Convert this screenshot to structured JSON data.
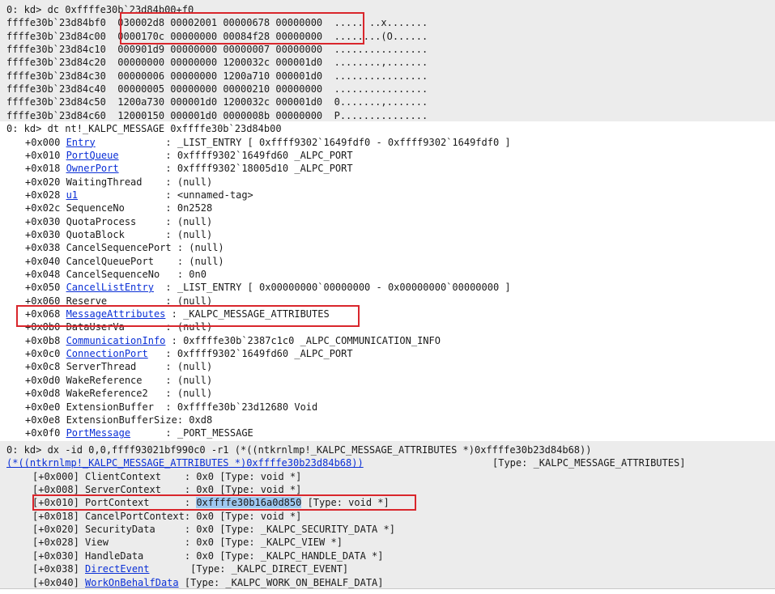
{
  "dump": {
    "prompt_prefix": "0: kd> ",
    "command": "dc 0xffffe30b`23d84b00+f0",
    "rows": [
      {
        "addr": "ffffe30b`23d84bf0",
        "data": "030002d8 00002001 00000678 00000000",
        "ascii": "..... ..x......."
      },
      {
        "addr": "ffffe30b`23d84c00",
        "data": "0000170c 00000000 00084f28 00000000",
        "ascii": "........(O......"
      },
      {
        "addr": "ffffe30b`23d84c10",
        "data": "000901d9 00000000 00000007 00000000",
        "ascii": "................"
      },
      {
        "addr": "ffffe30b`23d84c20",
        "data": "00000000 00000000 1200032c 000001d0",
        "ascii": "........,......."
      },
      {
        "addr": "ffffe30b`23d84c30",
        "data": "00000006 00000000 1200a710 000001d0",
        "ascii": "................"
      },
      {
        "addr": "ffffe30b`23d84c40",
        "data": "00000005 00000000 00000210 00000000",
        "ascii": "................"
      },
      {
        "addr": "ffffe30b`23d84c50",
        "data": "1200a730 000001d0 1200032c 000001d0",
        "ascii": "0.......,......."
      },
      {
        "addr": "ffffe30b`23d84c60",
        "data": "12000150 000001d0 0000008b 00000000",
        "ascii": "P..............."
      }
    ]
  },
  "dt": {
    "prompt_prefix": "0: kd> ",
    "command": "dt nt!_KALPC_MESSAGE 0xffffe30b`23d84b00",
    "fields": [
      {
        "offset": "+0x000 ",
        "name": "Entry",
        "link": true,
        "pad": "            ",
        "value": ": _LIST_ENTRY [ 0xffff9302`1649fdf0 - 0xffff9302`1649fdf0 ]"
      },
      {
        "offset": "+0x010 ",
        "name": "PortQueue",
        "link": true,
        "pad": "        ",
        "value": ": 0xffff9302`1649fd60 _ALPC_PORT"
      },
      {
        "offset": "+0x018 ",
        "name": "OwnerPort",
        "link": true,
        "pad": "        ",
        "value": ": 0xffff9302`18005d10 _ALPC_PORT"
      },
      {
        "offset": "+0x020 ",
        "name": "WaitingThread",
        "link": false,
        "pad": "    ",
        "value": ": (null)"
      },
      {
        "offset": "+0x028 ",
        "name": "u1",
        "link": true,
        "pad": "               ",
        "value": ": <unnamed-tag>"
      },
      {
        "offset": "+0x02c ",
        "name": "SequenceNo",
        "link": false,
        "pad": "       ",
        "value": ": 0n2528"
      },
      {
        "offset": "+0x030 ",
        "name": "QuotaProcess",
        "link": false,
        "pad": "     ",
        "value": ": (null)"
      },
      {
        "offset": "+0x030 ",
        "name": "QuotaBlock",
        "link": false,
        "pad": "       ",
        "value": ": (null)"
      },
      {
        "offset": "+0x038 ",
        "name": "CancelSequencePort",
        "link": false,
        "pad": " ",
        "value": ": (null)"
      },
      {
        "offset": "+0x040 ",
        "name": "CancelQueuePort",
        "link": false,
        "pad": "    ",
        "value": ": (null)"
      },
      {
        "offset": "+0x048 ",
        "name": "CancelSequenceNo",
        "link": false,
        "pad": "   ",
        "value": ": 0n0"
      },
      {
        "offset": "+0x050 ",
        "name": "CancelListEntry",
        "link": true,
        "pad": "  ",
        "value": ": _LIST_ENTRY [ 0x00000000`00000000 - 0x00000000`00000000 ]"
      },
      {
        "offset": "+0x060 ",
        "name": "Reserve",
        "link": false,
        "pad": "          ",
        "value": ": (null)"
      },
      {
        "offset": "+0x068 ",
        "name": "MessageAttributes",
        "link": true,
        "pad": " ",
        "value": ": _KALPC_MESSAGE_ATTRIBUTES"
      },
      {
        "offset": "+0x0b0 ",
        "name": "DataUserVa",
        "link": false,
        "pad": "       ",
        "value": ": (null)"
      },
      {
        "offset": "+0x0b8 ",
        "name": "CommunicationInfo",
        "link": true,
        "pad": " ",
        "value": ": 0xffffe30b`2387c1c0 _ALPC_COMMUNICATION_INFO"
      },
      {
        "offset": "+0x0c0 ",
        "name": "ConnectionPort",
        "link": true,
        "pad": "   ",
        "value": ": 0xffff9302`1649fd60 _ALPC_PORT"
      },
      {
        "offset": "+0x0c8 ",
        "name": "ServerThread",
        "link": false,
        "pad": "     ",
        "value": ": (null)"
      },
      {
        "offset": "+0x0d0 ",
        "name": "WakeReference",
        "link": false,
        "pad": "    ",
        "value": ": (null)"
      },
      {
        "offset": "+0x0d8 ",
        "name": "WakeReference2",
        "link": false,
        "pad": "   ",
        "value": ": (null)"
      },
      {
        "offset": "+0x0e0 ",
        "name": "ExtensionBuffer",
        "link": false,
        "pad": "  ",
        "value": ": 0xffffe30b`23d12680 Void"
      },
      {
        "offset": "+0x0e8 ",
        "name": "ExtensionBufferSize",
        "link": false,
        "pad": "",
        "value": ": 0xd8"
      },
      {
        "offset": "+0x0f0 ",
        "name": "PortMessage",
        "link": true,
        "pad": "      ",
        "value": ": _PORT_MESSAGE"
      }
    ]
  },
  "dx": {
    "prompt_prefix": "0: kd> ",
    "command": "dx -id 0,0,ffff93021bf990c0 -r1 (*((ntkrnlmp!_KALPC_MESSAGE_ATTRIBUTES *)0xffffe30b23d84b68))",
    "root_link": "(*((ntkrnlmp!_KALPC_MESSAGE_ATTRIBUTES *)0xffffe30b23d84b68))",
    "root_type": "[Type: _KALPC_MESSAGE_ATTRIBUTES]",
    "fields": [
      {
        "offset": "[+0x000] ",
        "name": "ClientContext",
        "link": false,
        "pad": "    ",
        "value": ": 0x0 [Type: void *]"
      },
      {
        "offset": "[+0x008] ",
        "name": "ServerContext",
        "link": false,
        "pad": "    ",
        "value": ": 0x0 [Type: void *]"
      },
      {
        "offset": "[+0x010] ",
        "name": "PortContext",
        "link": false,
        "pad": "      ",
        "value_prefix": ": ",
        "value_selected": "0xffffe30b16a0d850",
        "value": " [Type: void *]"
      },
      {
        "offset": "[+0x018] ",
        "name": "CancelPortContext",
        "link": false,
        "pad": "",
        "value": ": 0x0 [Type: void *]"
      },
      {
        "offset": "[+0x020] ",
        "name": "SecurityData",
        "link": false,
        "pad": "     ",
        "value": ": 0x0 [Type: _KALPC_SECURITY_DATA *]"
      },
      {
        "offset": "[+0x028] ",
        "name": "View",
        "link": false,
        "pad": "             ",
        "value": ": 0x0 [Type: _KALPC_VIEW *]"
      },
      {
        "offset": "[+0x030] ",
        "name": "HandleData",
        "link": false,
        "pad": "       ",
        "value": ": 0x0 [Type: _KALPC_HANDLE_DATA *]"
      },
      {
        "offset": "[+0x038] ",
        "name": "DirectEvent",
        "link": true,
        "pad": "      ",
        "value": " [Type: _KALPC_DIRECT_EVENT]"
      },
      {
        "offset": "[+0x040] ",
        "name": "WorkOnBehalfData",
        "link": true,
        "pad": " ",
        "value": "[Type: _KALPC_WORK_ON_BEHALF_DATA]"
      }
    ]
  },
  "colors": {
    "highlight_box": "#d9262c",
    "link": "#0a2fd6",
    "selection": "#9ec8f0"
  }
}
